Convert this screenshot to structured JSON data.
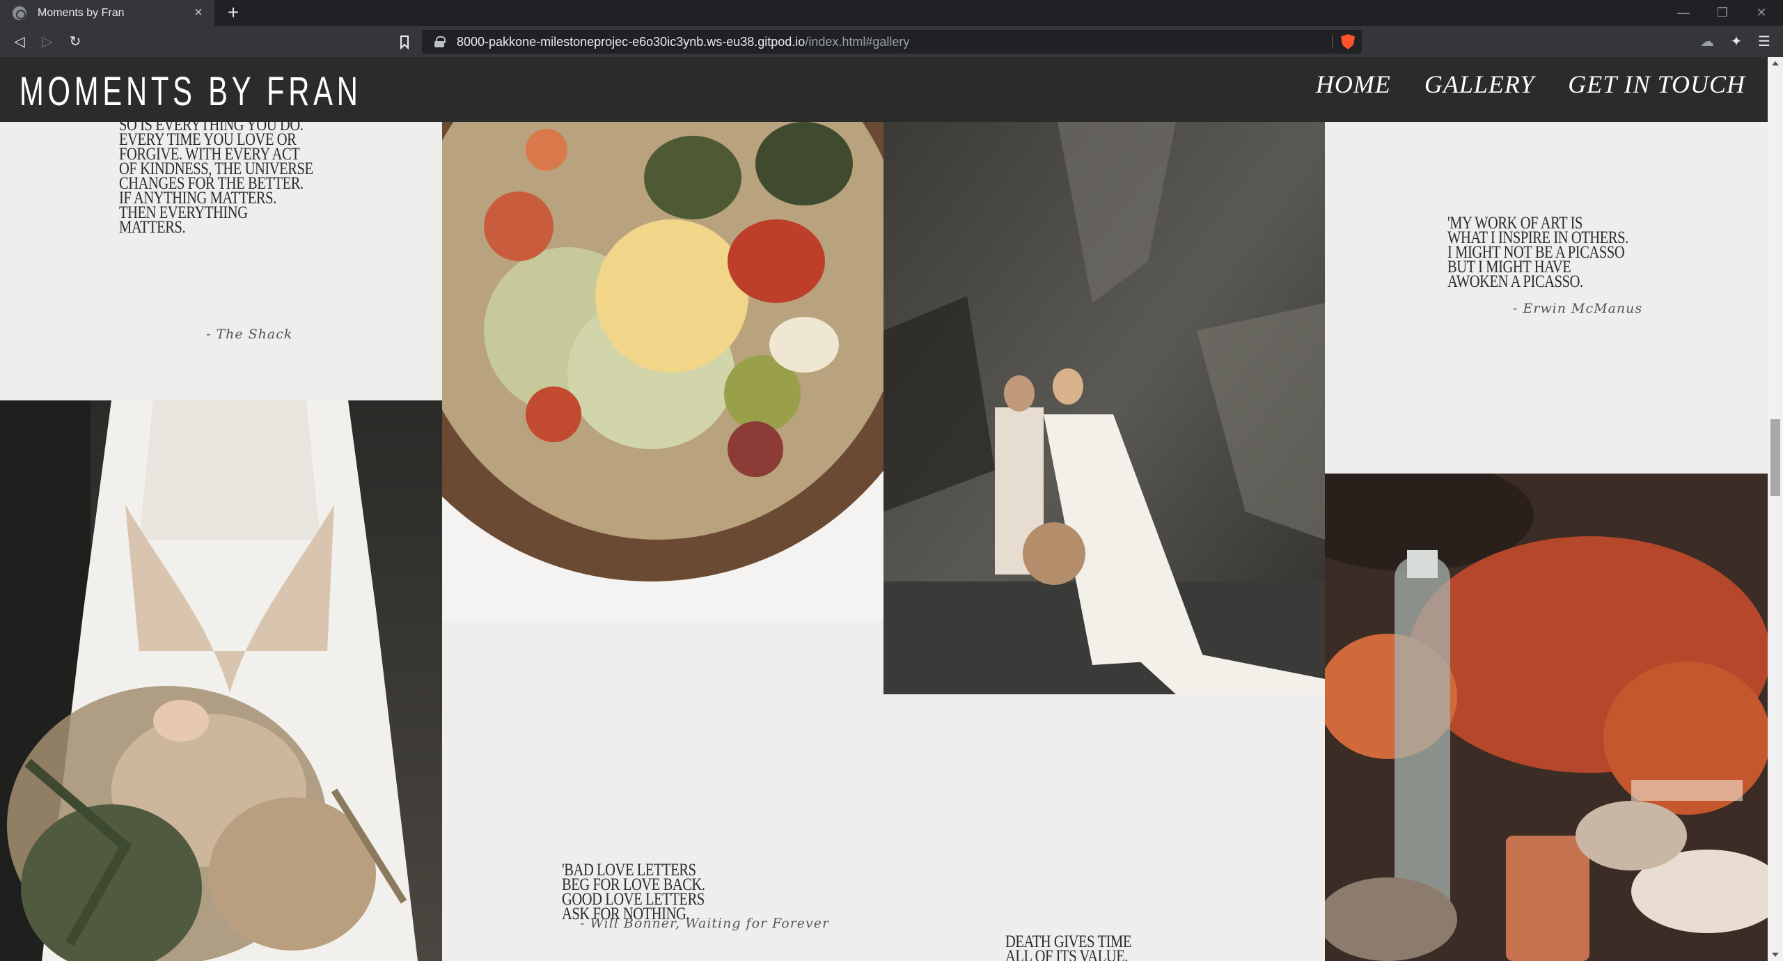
{
  "browser": {
    "tab_title": "Moments by Fran",
    "tab_close": "×",
    "new_tab": "+",
    "url_host": "8000-pakkone-milestoneprojec-e6o30ic3ynb.ws-eu38.gitpod.io",
    "url_path": "/index.html#gallery",
    "back": "◁",
    "forward": "▷",
    "reload": "↻",
    "minimize": "—",
    "restore": "❐",
    "close": "✕",
    "extensions": "✦",
    "menu": "☰",
    "cloud": "☁"
  },
  "site": {
    "logo": "MOMENTS BY FRAN",
    "nav": [
      {
        "label": "HOME"
      },
      {
        "label": "GALLERY"
      },
      {
        "label": "GET IN TOUCH"
      }
    ]
  },
  "gallery": {
    "quote1": {
      "lines": [
        "SO IS EVERYTHING YOU DO.",
        "EVERY TIME YOU LOVE OR",
        "FORGIVE. WITH EVERY ACT",
        "OF KINDNESS, THE UNIVERSE",
        "CHANGES FOR THE BETTER.",
        "IF ANYTHING MATTERS.",
        "THEN EVERYTHING",
        "MATTERS."
      ],
      "author": "- The Shack"
    },
    "quote2": {
      "lines": [
        "'MY WORK OF ART IS",
        "WHAT I INSPIRE IN OTHERS.",
        "I MIGHT NOT BE A PICASSO",
        "BUT I MIGHT HAVE",
        "AWOKEN A PICASSO."
      ],
      "author": "- Erwin McManus"
    },
    "quote3": {
      "lines": [
        "'BAD LOVE LETTERS",
        "BEG FOR LOVE BACK.",
        "GOOD LOVE LETTERS",
        "ASK FOR NOTHING."
      ],
      "author": "- Will Bonner, Waiting for Forever"
    },
    "quote4": {
      "lines": [
        "DEATH GIVES TIME",
        "ALL OF ITS VALUE."
      ]
    }
  }
}
